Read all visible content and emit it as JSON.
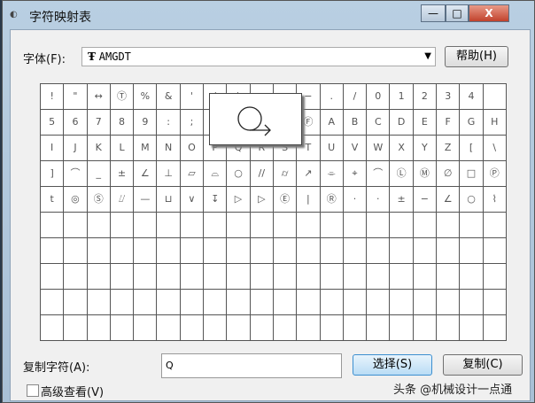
{
  "window": {
    "title": "字符映射表",
    "minimize": "—",
    "maximize": "□",
    "close": "X"
  },
  "font": {
    "label": "字体(F):",
    "value": "AMGDT",
    "icon": "truetype-icon",
    "help_button": "帮助(H)"
  },
  "grid": {
    "rows": [
      [
        "!",
        "\"",
        "↔",
        "Ⓣ",
        "%",
        "&",
        "'",
        "(",
        ")",
        "+",
        ",",
        "−",
        ".",
        "/",
        "0",
        "1",
        "2",
        "3",
        "4"
      ],
      [
        "5",
        "6",
        "7",
        "8",
        "9",
        ":",
        ";",
        "<",
        "=",
        ">",
        "?",
        "Ⓕ",
        "A",
        "B",
        "C",
        "D",
        "E",
        "F",
        "G",
        "H"
      ],
      [
        "I",
        "J",
        "K",
        "L",
        "M",
        "N",
        "O",
        "P",
        "Q",
        "R",
        "S",
        "T",
        "U",
        "V",
        "W",
        "X",
        "Y",
        "Z",
        "[",
        "\\"
      ],
      [
        "]",
        "⌒",
        "_",
        "±",
        "∠",
        "⊥",
        "▱",
        "⌓",
        "○",
        "//",
        "⌭",
        "↗",
        "⌯",
        "⌖",
        "⌒",
        "Ⓛ",
        "Ⓜ",
        "∅",
        "□",
        "Ⓟ"
      ],
      [
        "t",
        "◎",
        "Ⓢ",
        "⌰",
        "—",
        "⊔",
        "∨",
        "↧",
        "▷",
        "▷",
        "Ⓔ",
        "|",
        "Ⓡ",
        "·",
        "·",
        "±",
        "−",
        "∠",
        "○",
        "⌇"
      ]
    ],
    "total_rows": 10,
    "columns": 20
  },
  "popup": {
    "icon": "circle-arrow-symbol"
  },
  "copy": {
    "label": "复制字符(A):",
    "value": "Q",
    "select_button": "选择(S)",
    "copy_button": "复制(C)"
  },
  "advanced": {
    "label": "高级查看(V)",
    "checked": false
  },
  "watermark": "头条 @机械设计一点通"
}
